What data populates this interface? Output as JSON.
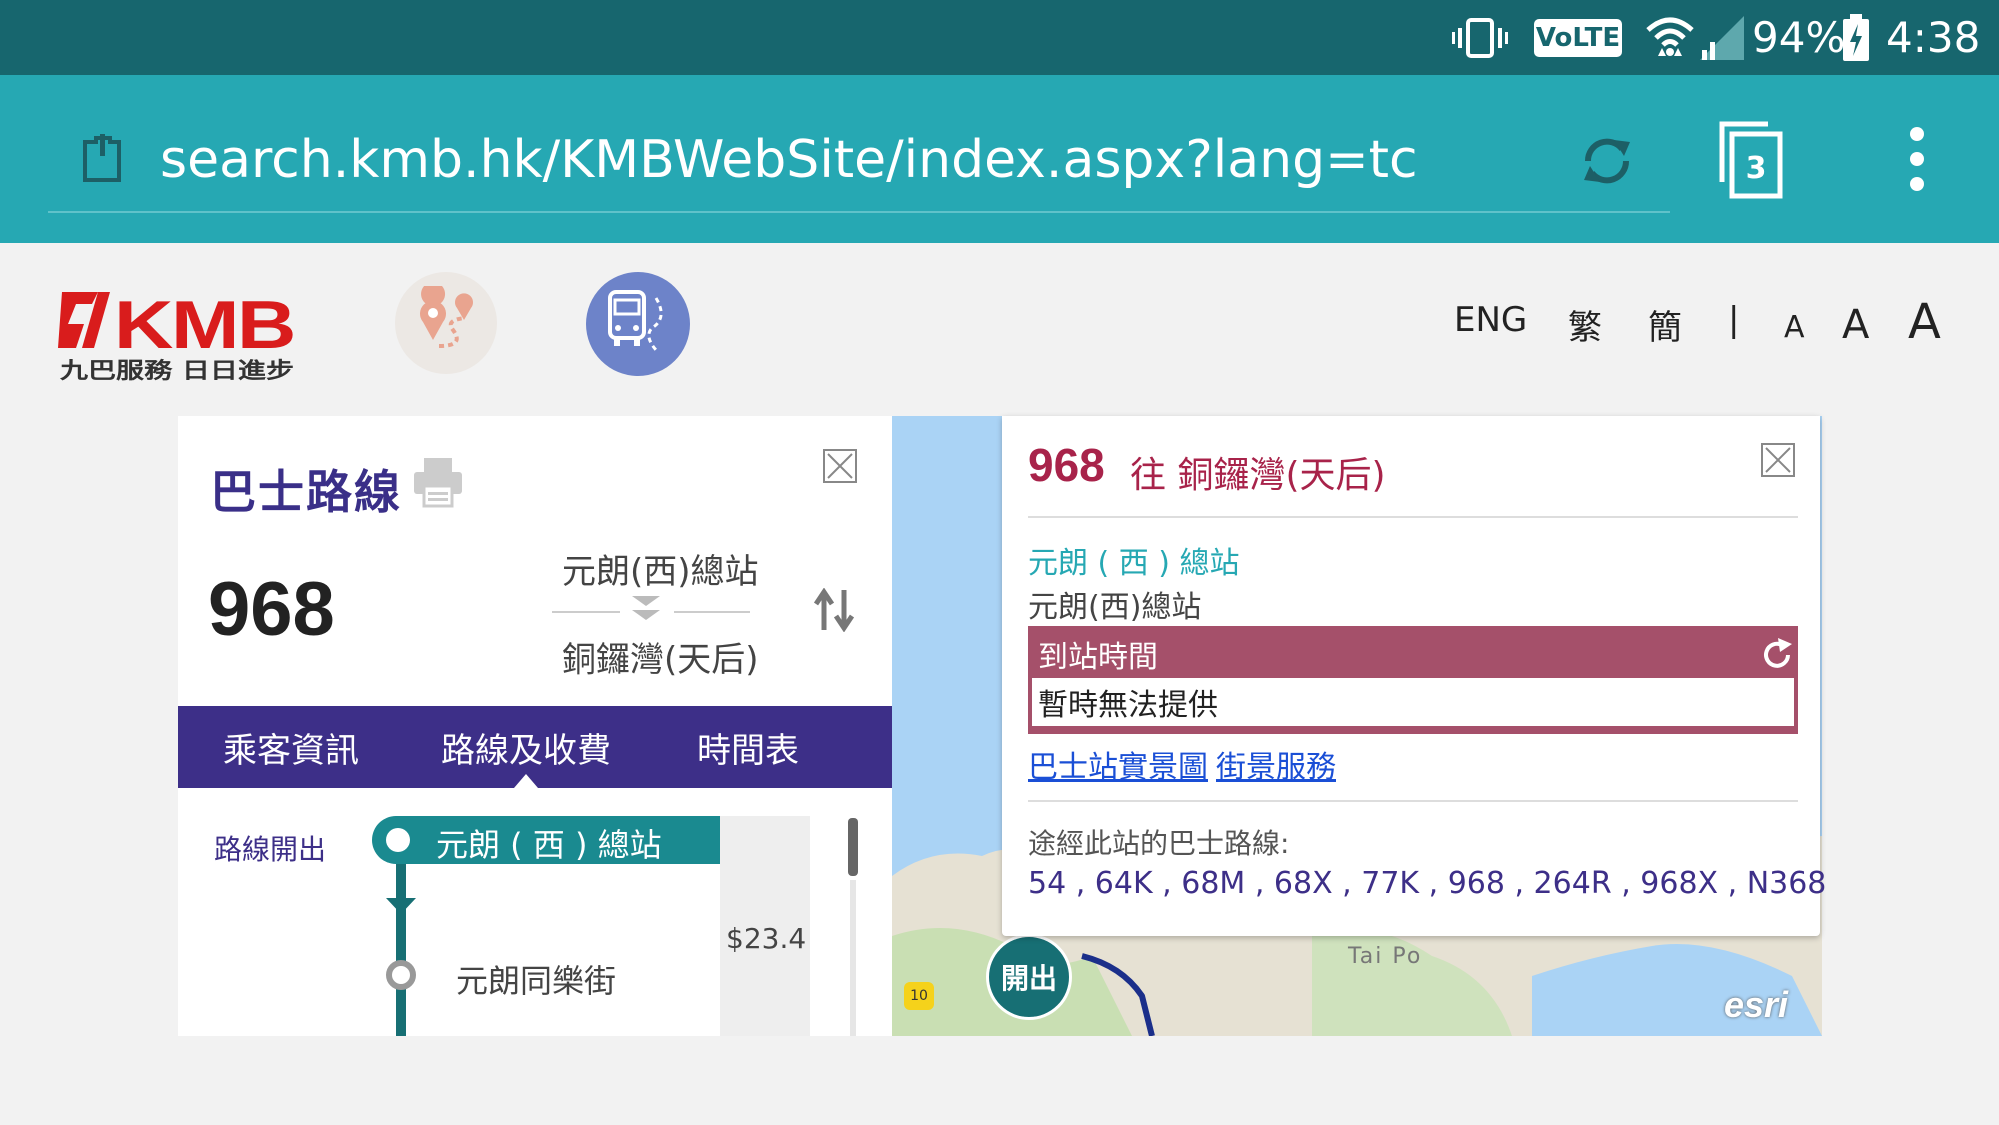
{
  "status_bar": {
    "battery_percent": "94%",
    "time": "4:38",
    "volte_label": "VoLTE",
    "icons": [
      "vibrate-icon",
      "volte-icon",
      "wifi-icon",
      "signal-icon",
      "battery-charging-icon"
    ]
  },
  "browser": {
    "url": "search.kmb.hk/KMBWebSite/index.aspx?lang=tc",
    "tab_count": "3",
    "icons": [
      "page-icon",
      "reload-icon",
      "tabs-icon",
      "more-menu-icon"
    ]
  },
  "header": {
    "logo_text": "KMB",
    "logo_tagline": "九巴服務 日日進步",
    "nav_icons": [
      "route-search-icon",
      "bus-route-icon"
    ],
    "languages": [
      "ENG",
      "繁",
      "簡"
    ],
    "divider": "|",
    "font_sizes": [
      "A",
      "A",
      "A"
    ]
  },
  "route_panel": {
    "title": "巴士路線",
    "route_number": "968",
    "origin": "元朗(西)總站",
    "destination": "銅鑼灣(天后)",
    "tabs": [
      "乘客資訊",
      "路線及收費",
      "時間表"
    ],
    "active_tab": 1,
    "direction_label": "路線開出",
    "stops": [
      {
        "name": "元朗 ( 西 ) 總站",
        "highlighted": true
      },
      {
        "name": "元朗同樂街",
        "highlighted": false
      }
    ],
    "fare": "$23.4"
  },
  "map": {
    "place_label": "Tai Po",
    "road_badge": "10",
    "marker_label": "開出",
    "attribution": "esri"
  },
  "popup": {
    "route_number": "968",
    "destination": "往 銅鑼灣(天后)",
    "stop_name_en_style": "元朗 ( 西 ) 總站",
    "stop_name": "元朗(西)總站",
    "eta_header": "到站時間",
    "eta_value": "暫時無法提供",
    "links": [
      "巴士站實景圖",
      "街景服務"
    ],
    "via_label": "途經此站的巴士路線:",
    "via_routes": "54 , 64K , 68M , 68X , 77K , 968 , 264R , 968X , N368"
  },
  "colors": {
    "status_bar": "#17666e",
    "url_bar": "#26a8b3",
    "brand_purple": "#3d2f88",
    "route_red": "#a8234a",
    "eta_bg": "#a5506a",
    "teal": "#1a8a90"
  }
}
